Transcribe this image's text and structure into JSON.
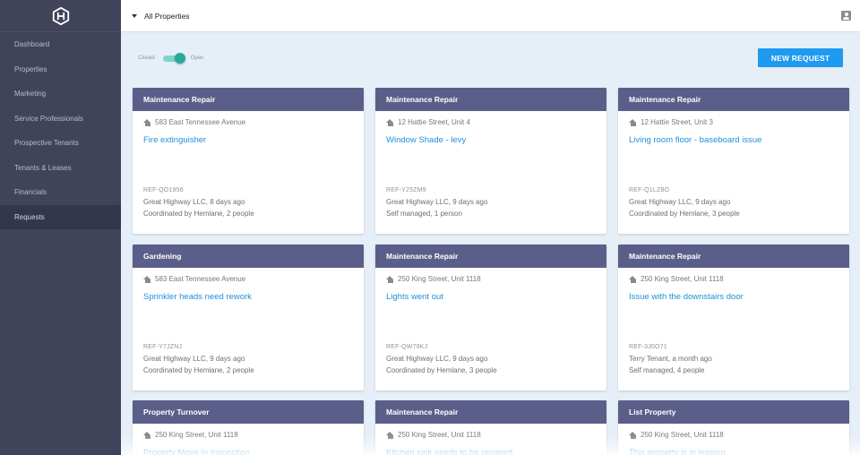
{
  "sidebar": {
    "items": [
      {
        "label": "Dashboard",
        "active": false
      },
      {
        "label": "Properties",
        "active": false
      },
      {
        "label": "Marketing",
        "active": false
      },
      {
        "label": "Service Professionals",
        "active": false
      },
      {
        "label": "Prospective Tenants",
        "active": false
      },
      {
        "label": "Tenants & Leases",
        "active": false
      },
      {
        "label": "Financials",
        "active": false
      },
      {
        "label": "Requests",
        "active": true
      }
    ]
  },
  "topbar": {
    "property_filter": "All Properties"
  },
  "toggle": {
    "left_label": "Closed",
    "right_label": "Open",
    "state": "Open"
  },
  "new_request_label": "NEW REQUEST",
  "cards": [
    {
      "category": "Maintenance Repair",
      "address": "583 East Tennessee Avenue",
      "title": "Fire extinguisher",
      "ref": "REF-QO1956",
      "owner": "Great Highway LLC, 8 days ago",
      "coordination": "Coordinated by Hemlane, 2 people"
    },
    {
      "category": "Maintenance Repair",
      "address": "12 Hattie Street, Unit 4",
      "title": "Window Shade - levy",
      "ref": "REF-Y25ZM9",
      "owner": "Great Highway LLC, 9 days ago",
      "coordination": "Self managed, 1 person"
    },
    {
      "category": "Maintenance Repair",
      "address": "12 Hattie Street, Unit 3",
      "title": "Living room floor - baseboard issue",
      "ref": "REF-Q1LZ8O",
      "owner": "Great Highway LLC, 9 days ago",
      "coordination": "Coordinated by Hemlane, 3 people"
    },
    {
      "category": "Gardening",
      "address": "583 East Tennessee Avenue",
      "title": "Sprinkler heads need rework",
      "ref": "REF-Y7JZNJ",
      "owner": "Great Highway LLC, 9 days ago",
      "coordination": "Coordinated by Hemlane, 2 people"
    },
    {
      "category": "Maintenance Repair",
      "address": "250 King Street, Unit 1118",
      "title": "Lights went out",
      "ref": "REF-QW79KJ",
      "owner": "Great Highway LLC, 9 days ago",
      "coordination": "Coordinated by Hemlane, 3 people"
    },
    {
      "category": "Maintenance Repair",
      "address": "250 King Street, Unit 1118",
      "title": "Issue with the downstairs door",
      "ref": "REF-3J0O71",
      "owner": "Terry Tenant, a month ago",
      "coordination": "Self managed, 4 people"
    },
    {
      "category": "Property Turnover",
      "address": "250 King Street, Unit 1118",
      "title": "Property Move In Inspection",
      "ref": "",
      "owner": "",
      "coordination": ""
    },
    {
      "category": "Maintenance Repair",
      "address": "250 King Street, Unit 1118",
      "title": "Kitchen sink needs to be repaired",
      "ref": "",
      "owner": "",
      "coordination": ""
    },
    {
      "category": "List Property",
      "address": "250 King Street, Unit 1118",
      "title": "This property is in leasing",
      "ref": "",
      "owner": "",
      "coordination": ""
    }
  ]
}
